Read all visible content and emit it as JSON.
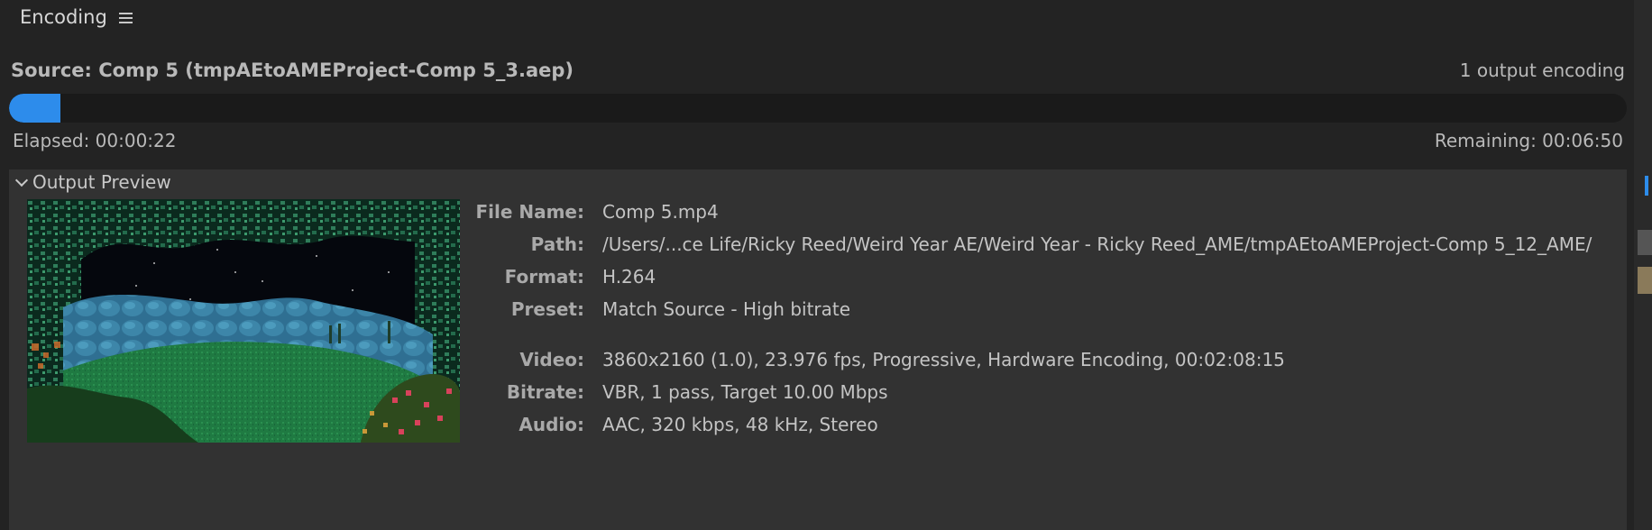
{
  "panel": {
    "tab_title": "Encoding",
    "menu_icon": "hamburger-menu-icon"
  },
  "source": {
    "text": "Source: Comp 5 (tmpAEtoAMEProject-Comp 5_3.aep)",
    "output_count": "1 output encoding"
  },
  "progress": {
    "fraction": 0.032,
    "elapsed": "Elapsed: 00:00:22",
    "remaining": "Remaining: 00:06:50",
    "color": "#2d8ceb"
  },
  "output_preview": {
    "title": "Output Preview",
    "details": [
      {
        "label": "File Name:",
        "value": "Comp 5.mp4"
      },
      {
        "label": "Path:",
        "value": "/Users/...ce Life/Ricky Reed/Weird Year AE/Weird Year - Ricky Reed_AME/tmpAEtoAMEProject-Comp 5_12_AME/"
      },
      {
        "label": "Format:",
        "value": "H.264"
      },
      {
        "label": "Preset:",
        "value": "Match Source - High bitrate"
      },
      {
        "label": "Video:",
        "value": "3860x2160 (1.0), 23.976 fps, Progressive, Hardware Encoding, 00:02:08:15"
      },
      {
        "label": "Bitrate:",
        "value": "VBR, 1 pass, Target 10.00 Mbps"
      },
      {
        "label": "Audio:",
        "value": "AAC, 320 kbps, 48 kHz, Stereo"
      }
    ]
  }
}
